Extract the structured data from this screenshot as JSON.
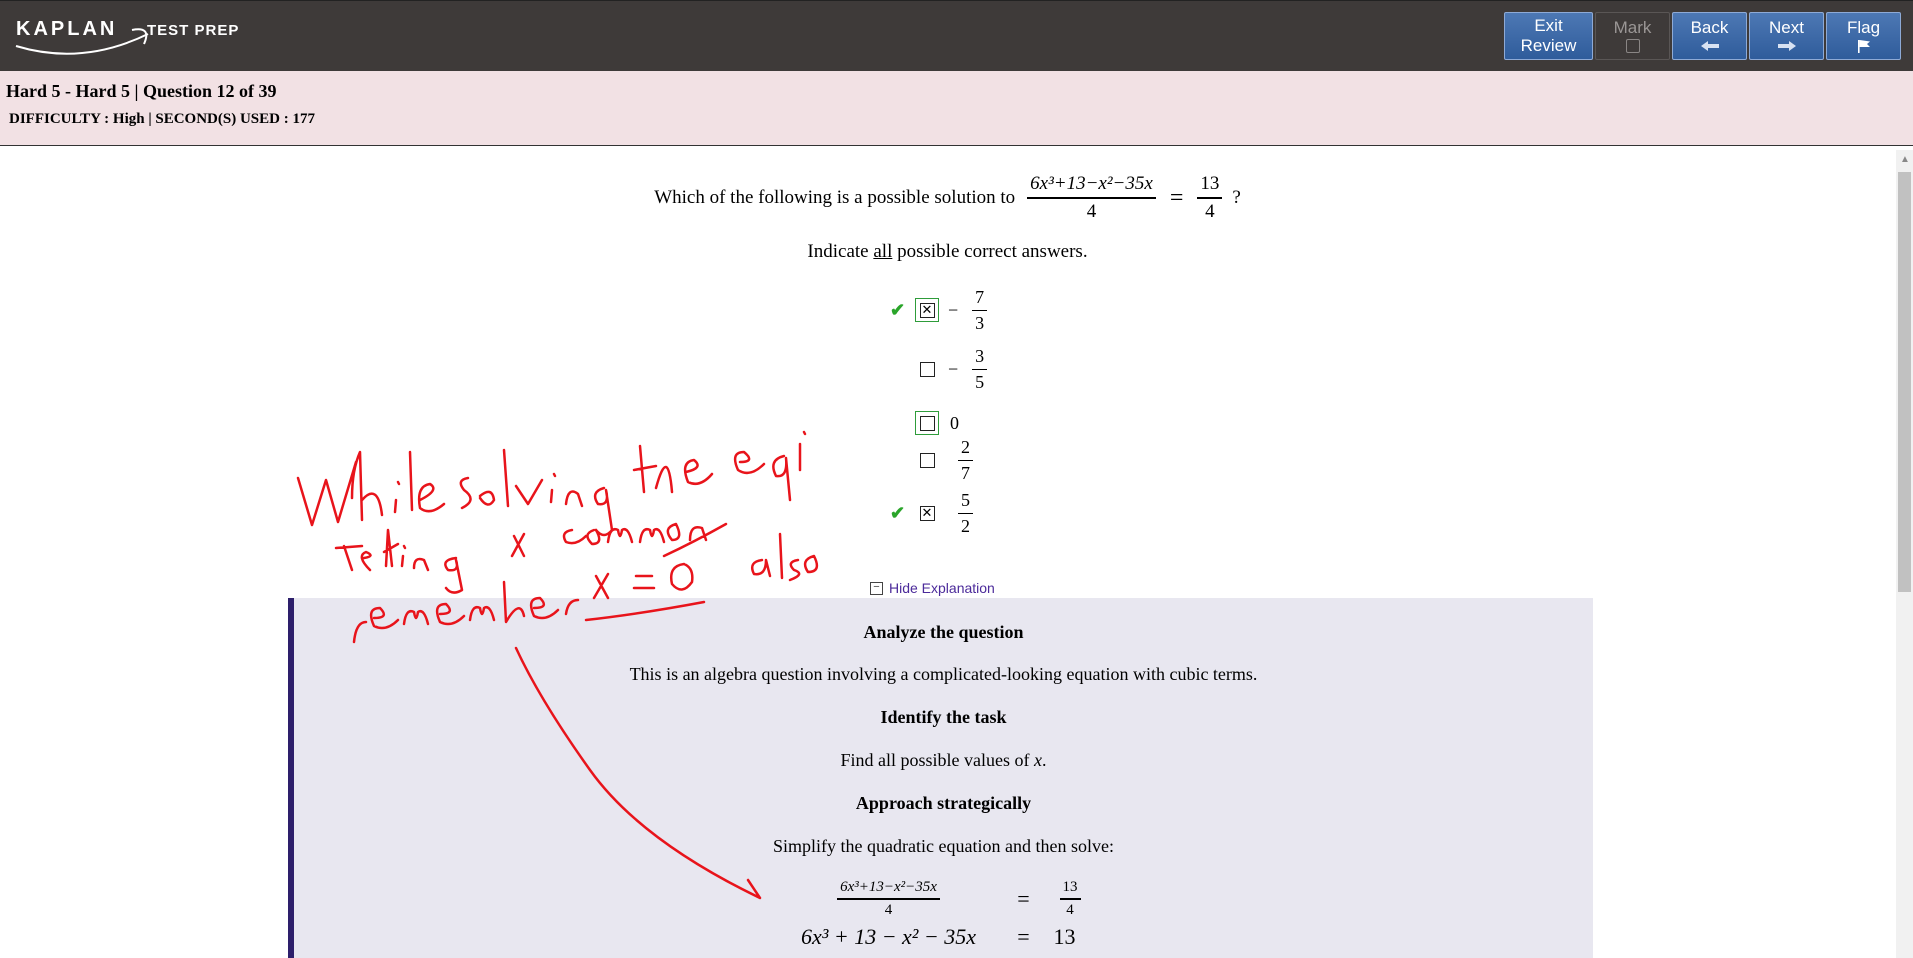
{
  "header": {
    "brand_name": "KAPLAN",
    "brand_tagline": "TEST PREP",
    "buttons": {
      "exit_review": [
        "Exit",
        "Review"
      ],
      "mark": "Mark",
      "back": "Back",
      "next": "Next",
      "flag": "Flag"
    }
  },
  "infobar": {
    "title": "Hard 5 - Hard 5 | Question 12 of 39",
    "meta": "DIFFICULTY : High | SECOND(S) USED : 177"
  },
  "question": {
    "stem_prefix": "Which of the following is a possible solution to",
    "stem_numerator": "6x³+13−x²−35x",
    "stem_denominator": "4",
    "equals": "=",
    "rhs_numerator": "13",
    "rhs_denominator": "4",
    "stem_suffix": "?",
    "instruction_before": "Indicate ",
    "instruction_underlined": "all",
    "instruction_after": " possible correct answers.",
    "choices": [
      {
        "sign": "−",
        "numerator": "7",
        "denominator": "3",
        "selected": true,
        "correct": true
      },
      {
        "sign": "−",
        "numerator": "3",
        "denominator": "5",
        "selected": false,
        "correct": false
      },
      {
        "value": "0",
        "selected": false,
        "correct": true
      },
      {
        "numerator": "2",
        "denominator": "7",
        "selected": false,
        "correct": false
      },
      {
        "numerator": "5",
        "denominator": "2",
        "selected": true,
        "correct": true
      }
    ],
    "check_symbol": "✔",
    "selected_symbol": "✕"
  },
  "explanation": {
    "toggle_label": "Hide Explanation",
    "sections": [
      {
        "heading": "Analyze the question",
        "body": "This is an algebra question involving a complicated-looking equation with cubic terms."
      },
      {
        "heading": "Identify the task",
        "body_before": "Find all possible values of ",
        "body_var": "x",
        "body_after": "."
      },
      {
        "heading": "Approach strategically",
        "body": "Simplify the quadratic equation and then solve:"
      }
    ],
    "eq1": {
      "lhs_num": "6x³+13−x²−35x",
      "lhs_den": "4",
      "op": "=",
      "rhs_num": "13",
      "rhs_den": "4"
    },
    "eq2": {
      "lhs": "6x³ + 13 − x² − 35x",
      "op": "=",
      "rhs": "13"
    }
  },
  "annotation": {
    "color": "#e8141b",
    "lines": [
      "While solving the eq",
      "taking x common",
      "remember x = 0 also"
    ]
  }
}
